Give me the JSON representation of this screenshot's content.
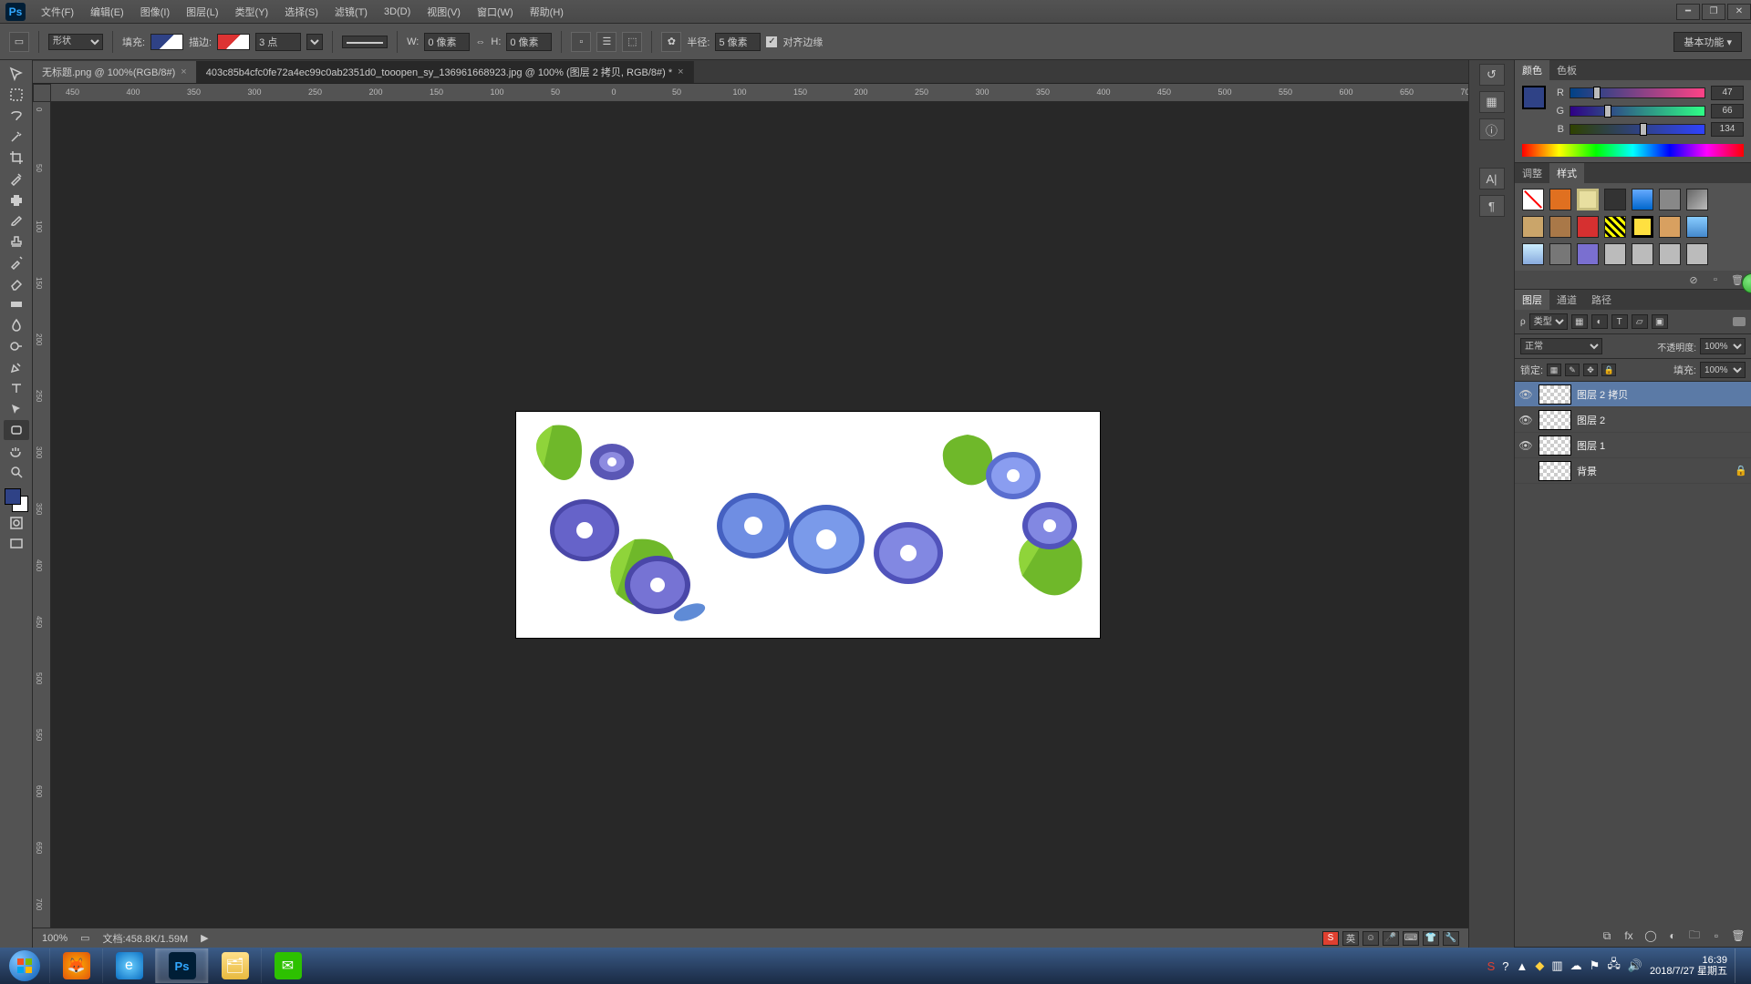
{
  "app_logo": "Ps",
  "menu": [
    "文件(F)",
    "编辑(E)",
    "图像(I)",
    "图层(L)",
    "类型(Y)",
    "选择(S)",
    "滤镜(T)",
    "3D(D)",
    "视图(V)",
    "窗口(W)",
    "帮助(H)"
  ],
  "workspace_label": "基本功能",
  "options": {
    "shape_mode": "形状",
    "fill_label": "填充:",
    "stroke_label": "描边:",
    "stroke_width": "3 点",
    "w_label": "W:",
    "w_value": "0 像素",
    "h_label": "H:",
    "h_value": "0 像素",
    "radius_label": "半径:",
    "radius_value": "5 像素",
    "align_label": "对齐边缘"
  },
  "tabs": [
    {
      "title": "无标题.png @ 100%(RGB/8#)",
      "active": false
    },
    {
      "title": "403c85b4cfc0fe72a4ec99c0ab2351d0_tooopen_sy_136961668923.jpg @ 100% (图层 2 拷贝, RGB/8#) *",
      "active": true
    }
  ],
  "ruler_start": -450,
  "ruler_end": 1200,
  "ruler_step": 50,
  "ruler_v_start": 0,
  "ruler_v_end": 750,
  "color_panel": {
    "tabs": [
      "颜色",
      "色板"
    ],
    "r": {
      "label": "R",
      "value": "47"
    },
    "g": {
      "label": "G",
      "value": "66"
    },
    "b": {
      "label": "B",
      "value": "134"
    },
    "swatch_hex": "#2f4286"
  },
  "adjust_panel": {
    "tabs": [
      "调整",
      "样式"
    ]
  },
  "layers_panel": {
    "tabs": [
      "图层",
      "通道",
      "路径"
    ],
    "filter_label": "类型",
    "blend_mode": "正常",
    "opacity_label": "不透明度:",
    "opacity_value": "100%",
    "lock_label": "锁定:",
    "fill_label": "填充:",
    "fill_value": "100%",
    "layers": [
      {
        "name": "图层 2 拷贝",
        "visible": true,
        "selected": true,
        "locked": false
      },
      {
        "name": "图层 2",
        "visible": true,
        "selected": false,
        "locked": false
      },
      {
        "name": "图层 1",
        "visible": true,
        "selected": false,
        "locked": false
      },
      {
        "name": "背景",
        "visible": false,
        "selected": false,
        "locked": true
      }
    ]
  },
  "status": {
    "zoom": "100%",
    "doc_label": "文档:",
    "doc_size": "458.8K/1.59M",
    "ime": "英"
  },
  "taskbar": {
    "time": "16:39",
    "date": "2018/7/27",
    "day": "星期五"
  }
}
